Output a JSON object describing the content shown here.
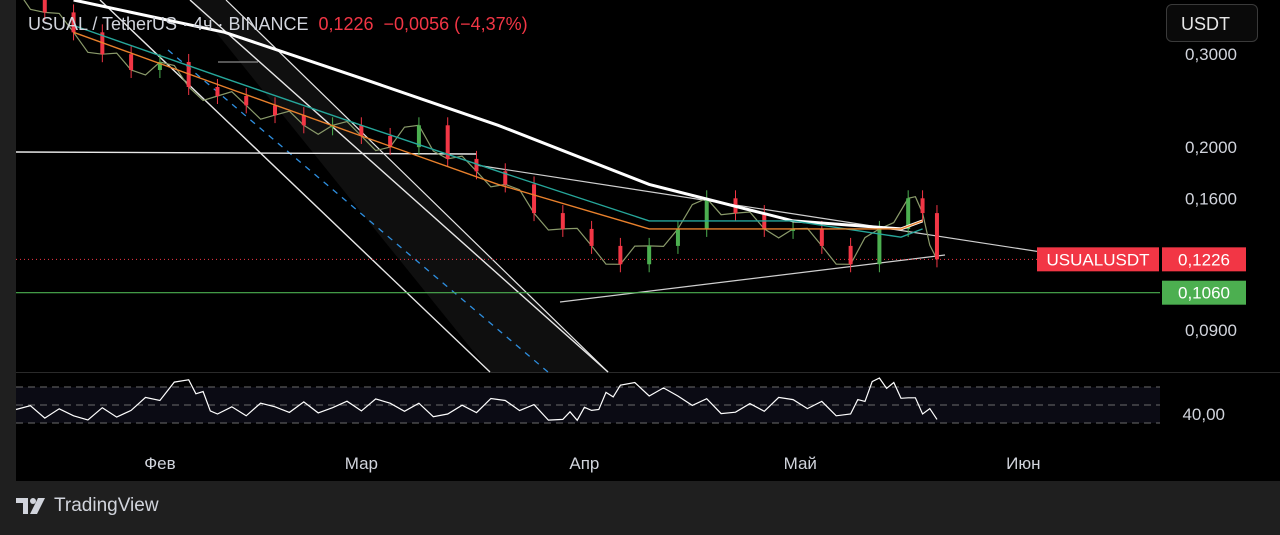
{
  "header": {
    "symbol": "USUAL / TetherUS · 4ч · BINANCE",
    "price": "0,1226",
    "change": "−0,0056 (−4,37%)"
  },
  "currency_button": "USDT",
  "footer": {
    "brand": "TradingView"
  },
  "colors": {
    "background": "#000000",
    "bear": "#f23645",
    "bull": "#4caf50",
    "text": "#d1d4dc",
    "ma_white": "#ffffff",
    "ma_teal": "#26a69a",
    "ma_orange": "#e8802c",
    "ma_red": "#d6453a",
    "rsi_dash": "#6b6b6b",
    "channel_dash": "#2e8fe0"
  },
  "chart_data": [
    {
      "type": "line",
      "title": "",
      "symbol": "USUALUSDT",
      "timeframe": "4ч",
      "exchange": "BINANCE",
      "y_scale": "log",
      "ylim": [
        0.075,
        0.38
      ],
      "y_ticks": [
        "0,3000",
        "0,2000",
        "0,1600",
        "0,0900"
      ],
      "x_ticks": [
        "Фев",
        "Мар",
        "Апр",
        "Май",
        "Июн"
      ],
      "x_range": [
        "2025-01-12",
        "2025-06-20"
      ],
      "grid": false,
      "price_series": {
        "name": "",
        "x": [
          "2025-01-12",
          "2025-01-16",
          "2025-01-20",
          "2025-01-24",
          "2025-01-28",
          "2025-02-01",
          "2025-02-05",
          "2025-02-09",
          "2025-02-13",
          "2025-02-17",
          "2025-02-21",
          "2025-02-25",
          "2025-03-01",
          "2025-03-05",
          "2025-03-09",
          "2025-03-13",
          "2025-03-17",
          "2025-03-21",
          "2025-03-25",
          "2025-03-29",
          "2025-04-02",
          "2025-04-06",
          "2025-04-10",
          "2025-04-14",
          "2025-04-18",
          "2025-04-22",
          "2025-04-26",
          "2025-04-30",
          "2025-05-04",
          "2025-05-08",
          "2025-05-12",
          "2025-05-16",
          "2025-05-18",
          "2025-05-20"
        ],
        "y": [
          0.4,
          0.36,
          0.33,
          0.3,
          0.28,
          0.29,
          0.26,
          0.25,
          0.24,
          0.23,
          0.22,
          0.22,
          0.21,
          0.2,
          0.22,
          0.19,
          0.18,
          0.17,
          0.15,
          0.14,
          0.13,
          0.12,
          0.13,
          0.14,
          0.16,
          0.15,
          0.14,
          0.14,
          0.13,
          0.12,
          0.14,
          0.16,
          0.15,
          0.1226
        ]
      },
      "ma_series": [
        {
          "color": "#ffffff",
          "x": [
            "2025-01-20",
            "2025-02-10",
            "2025-03-01",
            "2025-03-20",
            "2025-04-10",
            "2025-04-30",
            "2025-05-15",
            "2025-05-18"
          ],
          "y": [
            0.38,
            0.33,
            0.27,
            0.22,
            0.17,
            0.145,
            0.14,
            0.145
          ]
        },
        {
          "color": "#26a69a",
          "x": [
            "2025-01-20",
            "2025-02-10",
            "2025-03-01",
            "2025-03-20",
            "2025-04-10",
            "2025-04-30",
            "2025-05-15",
            "2025-05-18"
          ],
          "y": [
            0.34,
            0.27,
            0.22,
            0.18,
            0.145,
            0.145,
            0.135,
            0.14
          ]
        },
        {
          "color": "#e8802c",
          "x": [
            "2025-01-20",
            "2025-02-10",
            "2025-03-01",
            "2025-03-20",
            "2025-04-10",
            "2025-04-30",
            "2025-05-15",
            "2025-05-18"
          ],
          "y": [
            0.33,
            0.26,
            0.21,
            0.17,
            0.14,
            0.14,
            0.14,
            0.145
          ]
        }
      ],
      "price_labels": [
        {
          "text": "USUALUSDT",
          "value": "0,1226",
          "color": "#f23645"
        },
        {
          "text": "",
          "value": "0,1060",
          "color": "#4caf50"
        }
      ]
    },
    {
      "type": "line",
      "title": "",
      "name": "",
      "y_ticks": [
        "40,00"
      ],
      "x_range": [
        "2025-01-12",
        "2025-05-20"
      ],
      "ylim": [
        20,
        80
      ],
      "bands": [
        70,
        50,
        30
      ],
      "x": [
        "2025-01-12",
        "2025-01-20",
        "2025-01-28",
        "2025-02-05",
        "2025-02-09",
        "2025-02-17",
        "2025-02-25",
        "2025-03-05",
        "2025-03-13",
        "2025-03-21",
        "2025-03-29",
        "2025-04-02",
        "2025-04-06",
        "2025-04-14",
        "2025-04-22",
        "2025-04-30",
        "2025-05-08",
        "2025-05-12",
        "2025-05-16",
        "2025-05-20"
      ],
      "y": [
        45,
        38,
        44,
        78,
        40,
        48,
        47,
        52,
        40,
        55,
        34,
        44,
        72,
        60,
        42,
        56,
        40,
        80,
        58,
        34
      ]
    }
  ]
}
